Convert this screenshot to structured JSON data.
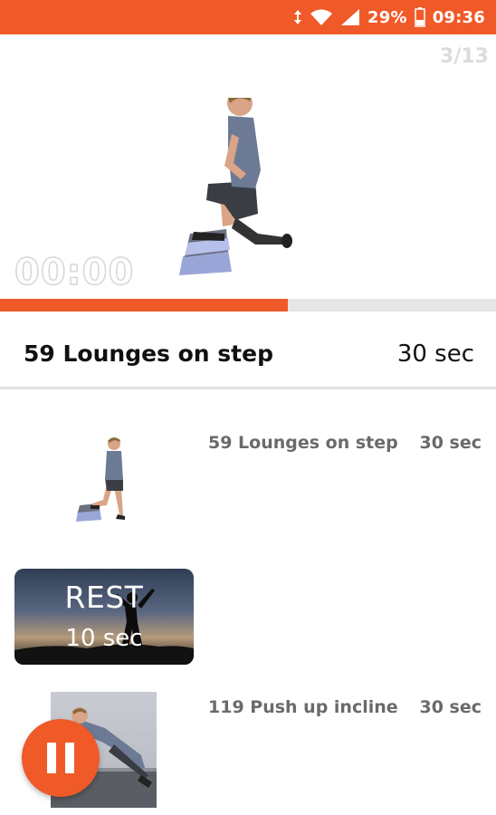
{
  "status_bar": {
    "battery_percent": "29%",
    "time": "09:36",
    "colors": {
      "background": "#f05a28"
    },
    "icons": [
      "data-arrows-icon",
      "wifi-icon",
      "signal-icon",
      "battery-icon"
    ]
  },
  "player": {
    "counter": "3/13",
    "timer": "00:00",
    "progress_fraction": 0.58,
    "colors": {
      "progress": "#f05a28",
      "track": "#e6e6e6"
    }
  },
  "current_exercise": {
    "title": "59 Lounges on step",
    "duration": "30 sec"
  },
  "list": {
    "items": [
      {
        "name": "59 Lounges on step",
        "duration": "30 sec"
      },
      {
        "rest_title": "REST",
        "rest_duration": "10 sec"
      },
      {
        "name": "119 Push up incline",
        "duration": "30 sec"
      }
    ]
  },
  "controls": {
    "pause_icon": "pause-icon",
    "color": "#f05a28"
  }
}
